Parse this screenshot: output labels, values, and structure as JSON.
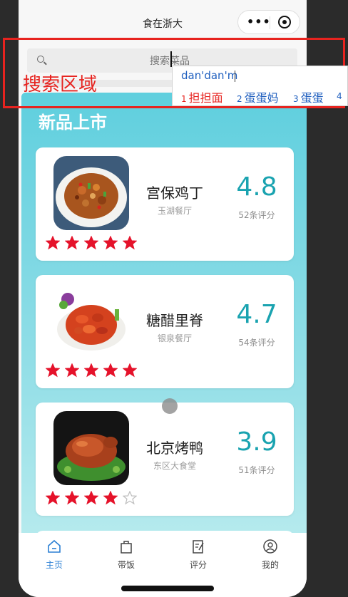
{
  "navbar": {
    "title": "食在浙大"
  },
  "search": {
    "placeholder": "搜索菜品"
  },
  "hero": {
    "title": "新品上市"
  },
  "dishes": [
    {
      "name": "宫保鸡丁",
      "restaurant": "玉湖餐厅",
      "score": "4.8",
      "reviews": "52条评分",
      "stars_filled": 5
    },
    {
      "name": "糖醋里脊",
      "restaurant": "银泉餐厅",
      "score": "4.7",
      "reviews": "54条评分",
      "stars_filled": 5
    },
    {
      "name": "北京烤鸭",
      "restaurant": "东区大食堂",
      "score": "3.9",
      "reviews": "51条评分",
      "stars_filled": 4
    }
  ],
  "tabs": [
    {
      "label": "主页",
      "icon": "home-icon"
    },
    {
      "label": "带饭",
      "icon": "bag-icon"
    },
    {
      "label": "评分",
      "icon": "edit-note-icon"
    },
    {
      "label": "我的",
      "icon": "user-icon"
    }
  ],
  "annotation": {
    "label": "搜索区域"
  },
  "ime": {
    "composition": "dan'dan'm",
    "candidates": [
      {
        "num": "1",
        "word": "担担面"
      },
      {
        "num": "2",
        "word": "蛋蛋妈"
      },
      {
        "num": "3",
        "word": "蛋蛋"
      },
      {
        "num": "4",
        "word": ""
      }
    ]
  },
  "colors": {
    "accent": "#1aa3b0",
    "tab_active": "#2a7fd4",
    "star": "#e5122a",
    "annotation": "#e7231f"
  }
}
